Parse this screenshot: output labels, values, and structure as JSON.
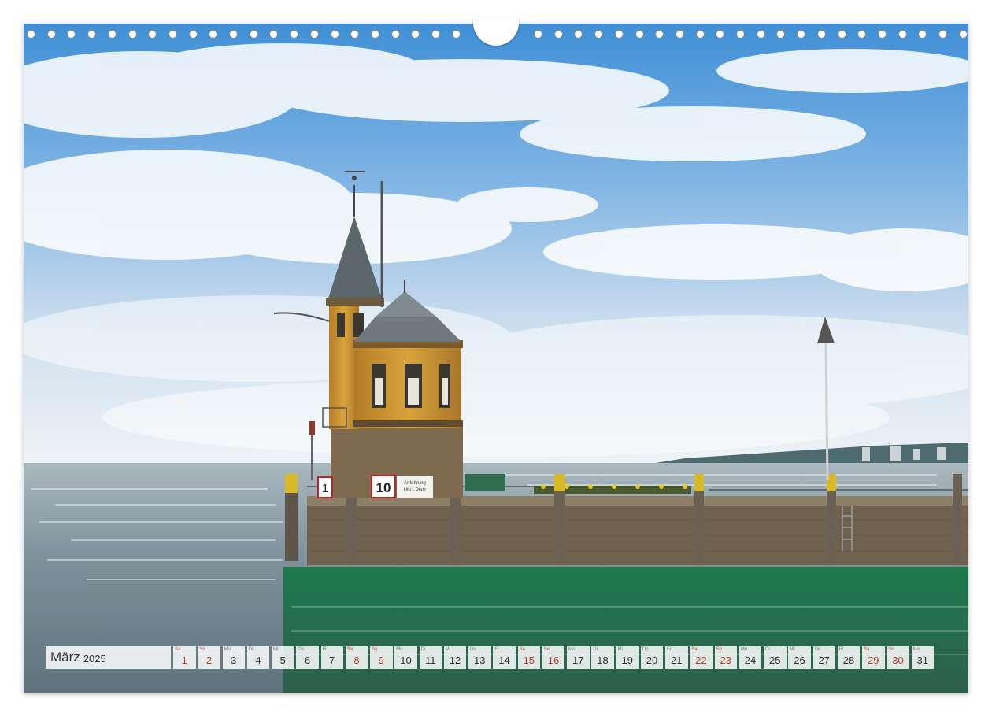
{
  "calendar": {
    "month": "März",
    "year": "2025",
    "days": [
      {
        "wd": "Sa",
        "num": "1",
        "weekend": true
      },
      {
        "wd": "So",
        "num": "2",
        "weekend": true
      },
      {
        "wd": "Mo",
        "num": "3",
        "weekend": false
      },
      {
        "wd": "Di",
        "num": "4",
        "weekend": false
      },
      {
        "wd": "Mi",
        "num": "5",
        "weekend": false
      },
      {
        "wd": "Do",
        "num": "6",
        "weekend": false
      },
      {
        "wd": "Fr",
        "num": "7",
        "weekend": false
      },
      {
        "wd": "Sa",
        "num": "8",
        "weekend": true
      },
      {
        "wd": "So",
        "num": "9",
        "weekend": true
      },
      {
        "wd": "Mo",
        "num": "10",
        "weekend": false
      },
      {
        "wd": "Di",
        "num": "11",
        "weekend": false
      },
      {
        "wd": "Mi",
        "num": "12",
        "weekend": false
      },
      {
        "wd": "Do",
        "num": "13",
        "weekend": false
      },
      {
        "wd": "Fr",
        "num": "14",
        "weekend": false
      },
      {
        "wd": "Sa",
        "num": "15",
        "weekend": true
      },
      {
        "wd": "So",
        "num": "16",
        "weekend": true
      },
      {
        "wd": "Mo",
        "num": "17",
        "weekend": false
      },
      {
        "wd": "Di",
        "num": "18",
        "weekend": false
      },
      {
        "wd": "Mi",
        "num": "19",
        "weekend": false
      },
      {
        "wd": "Do",
        "num": "20",
        "weekend": false
      },
      {
        "wd": "Fr",
        "num": "21",
        "weekend": false
      },
      {
        "wd": "Sa",
        "num": "22",
        "weekend": true
      },
      {
        "wd": "So",
        "num": "23",
        "weekend": true
      },
      {
        "wd": "Mo",
        "num": "24",
        "weekend": false
      },
      {
        "wd": "Di",
        "num": "25",
        "weekend": false
      },
      {
        "wd": "Mi",
        "num": "26",
        "weekend": false
      },
      {
        "wd": "Do",
        "num": "27",
        "weekend": false
      },
      {
        "wd": "Fr",
        "num": "28",
        "weekend": false
      },
      {
        "wd": "Sa",
        "num": "29",
        "weekend": true
      },
      {
        "wd": "So",
        "num": "30",
        "weekend": true
      },
      {
        "wd": "Mo",
        "num": "31",
        "weekend": false
      }
    ]
  },
  "photo": {
    "sign_number": "10",
    "sign_pier": "1",
    "sign_text_line1": "Anfahrung",
    "sign_text_line2": "Uhr - Platz"
  },
  "colors": {
    "sky_top": "#3f8fd6",
    "water": "#7d9099",
    "water_green": "#1c6b45",
    "brick": "#c8922f",
    "stone": "#7e6a4e",
    "roof": "#6f7a7e",
    "weekend": "#c0392b"
  }
}
